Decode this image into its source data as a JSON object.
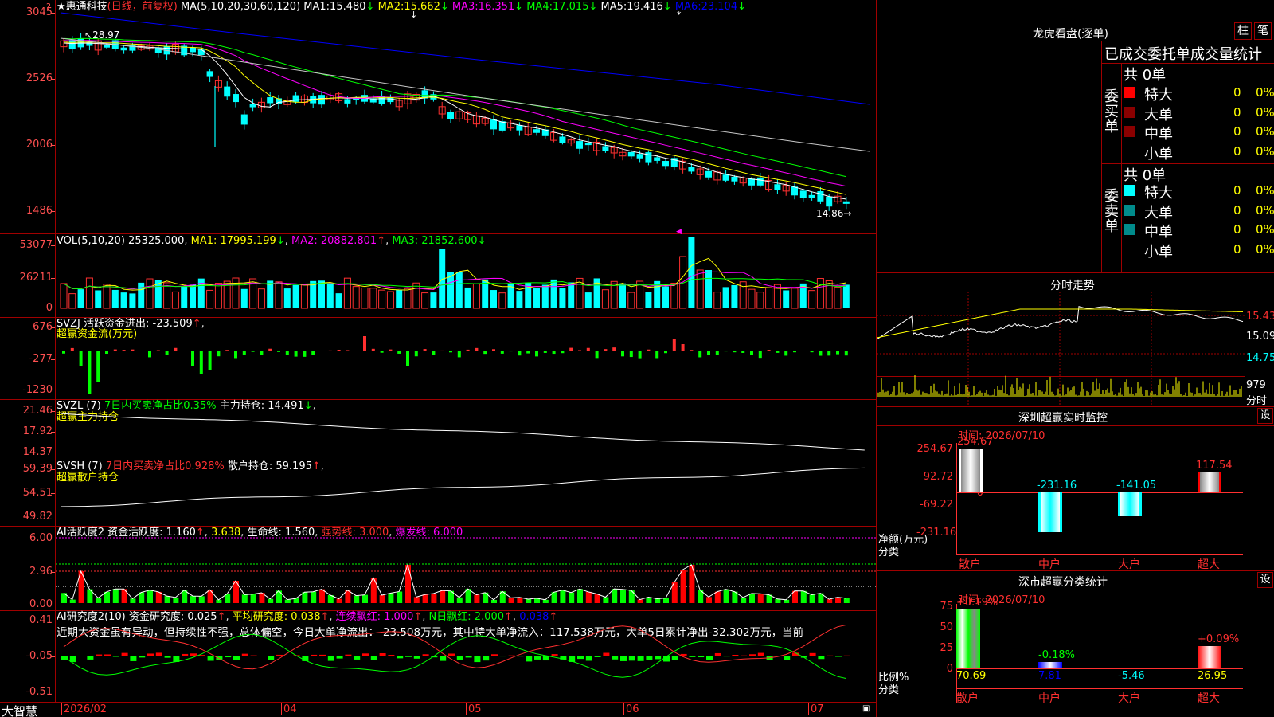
{
  "stock": {
    "star": "★",
    "name": "惠通科技",
    "period": "(日线，前复权)",
    "ma_header": "MA(5,10,20,30,60,120)",
    "ma": [
      {
        "label": "MA1:",
        "value": "15.480",
        "arrow": "↓",
        "color": "#ffffff"
      },
      {
        "label": "MA2:",
        "value": "15.662",
        "arrow": "↓",
        "color": "#ffff00"
      },
      {
        "label": "MA3:",
        "value": "16.351",
        "arrow": "↓",
        "color": "#ff00ff"
      },
      {
        "label": "MA4:",
        "value": "17.015",
        "arrow": "↓",
        "color": "#00ff00"
      },
      {
        "label": "MA5:",
        "value": "19.416",
        "arrow": "↓",
        "color": "#ffffff"
      },
      {
        "label": "MA6:",
        "value": "23.104",
        "arrow": "↓",
        "color": "#0000ff"
      }
    ],
    "price_labels": [
      "3045",
      "2526",
      "2006",
      "1486"
    ],
    "high_mark": "28.97",
    "low_mark": "14.86"
  },
  "vol": {
    "header": "VOL(5,10,20)",
    "value": "25325.000",
    "ma1": "MA1: 17995.199",
    "ma1_arrow": "↓",
    "ma2": "MA2: 20882.801",
    "ma2_arrow": "↑",
    "ma3": "MA3: 21852.600",
    "ma3_arrow": "↓",
    "labels": [
      "53077",
      "26211",
      "0"
    ]
  },
  "svzj": {
    "name": "SVZJ",
    "text": "活跃资金进出: -23.509",
    "arrow": "↑",
    "subtitle": "超赢资金流(万元)",
    "labels": [
      "676",
      "-277",
      "-1230"
    ]
  },
  "svzl": {
    "name": "SVZL (7)",
    "text": "7日内买卖净占比0.35%",
    "main": "主力持仓: 14.491",
    "arrow": "↓",
    "subtitle": "超赢主力持仓",
    "labels": [
      "21.46",
      "17.92",
      "14.37"
    ]
  },
  "svsh": {
    "name": "SVSH (7)",
    "text": "7日内买卖净占比0.928%",
    "retail": "散户持仓: 59.195",
    "arrow": "↑",
    "subtitle": "超赢散户持仓",
    "labels": [
      "59.39",
      "54.51",
      "49.82"
    ]
  },
  "ai1": {
    "name": "AI活跃度2",
    "a": "资金活跃度: 1.160",
    "a_arrow": "↑",
    "b": "3.638",
    "c": "生命线: 1.560",
    "d": "强势线: 3.000",
    "e": "爆发线: 6.000",
    "labels": [
      "6.00",
      "2.96",
      "0.00"
    ]
  },
  "ai2": {
    "name": "AI研究度2(10)",
    "a": "资金研究度: 0.025",
    "a_arrow": "↑",
    "b": "平均研究度: 0.038",
    "b_arrow": "↑",
    "c": "连续飘红: 1.000",
    "c_arrow": "↑",
    "d": "N日飘红: 2.000",
    "d_arrow": "↑",
    "e": "0.038",
    "e_arrow": "↑",
    "comment": "近期大资金虽有异动，但持续性不强，总体偏空，今日大单净流出：-23.508万元，其中特大单净流入：117.538万元，大单5日累计净出-32.302万元，当前",
    "labels": [
      "0.41",
      "-0.05",
      "-0.51"
    ]
  },
  "bottom": {
    "brand": "大智慧",
    "dates": [
      "2026/02",
      "04",
      "05",
      "06",
      "07"
    ]
  },
  "right": {
    "title": "龙虎看盘(逐单)",
    "tab1": "柱",
    "tab2": "笔",
    "stat_title": "已成交委托单成交量统计",
    "buy_side": "委买单",
    "sell_side": "委卖单",
    "total_buy": "共 0单",
    "total_sell": "共 0单",
    "rows": [
      {
        "name": "特大",
        "count": "0",
        "pct": "0%"
      },
      {
        "name": "大单",
        "count": "0",
        "pct": "0%"
      },
      {
        "name": "中单",
        "count": "0",
        "pct": "0%"
      },
      {
        "name": "小单",
        "count": "0",
        "pct": "0%"
      }
    ],
    "buy_colors": [
      "#ff0000",
      "#8b0000",
      "#8b0000",
      ""
    ],
    "sell_colors": [
      "#00ffff",
      "#008b8b",
      "#008b8b",
      ""
    ],
    "intraday_title": "分时走势",
    "intraday_labels": [
      "15.43",
      "15.09",
      "14.75"
    ],
    "intraday_vol_label": "979",
    "intraday_sub": "分时",
    "monitor_title": "深圳超赢实时监控",
    "settings": "设",
    "monitor_time": "时间: 2026/07/10",
    "monitor_labels": [
      "254.67",
      "92.72",
      "0",
      "-69.22",
      "-231.16"
    ],
    "monitor_axis_title": "净额(万元)",
    "monitor_axis_sub": "分类",
    "monitor_bars": [
      {
        "cat": "散户",
        "value": 254.67,
        "label": "254.67"
      },
      {
        "cat": "中户",
        "value": -231.16,
        "label": "-231.16"
      },
      {
        "cat": "大户",
        "value": -141.05,
        "label": "-141.05"
      },
      {
        "cat": "超大",
        "value": 117.54,
        "label": "117.54"
      }
    ],
    "class_title": "深市超赢分类统计",
    "class_time": "时间: 2026/07/10",
    "class_labels": [
      "75",
      "50",
      "25",
      "0"
    ],
    "class_axis_title": "比例%",
    "class_axis_sub": "分类",
    "class_bars": [
      {
        "cat": "散户",
        "value": 70.69,
        "top_label": "+0.19%",
        "bottom_label": "70.69"
      },
      {
        "cat": "中户",
        "value": 7.81,
        "top_label": "-0.18%",
        "bottom_label": "7.81"
      },
      {
        "cat": "大户",
        "value": 0,
        "top_label": "",
        "bottom_label": "-5.46"
      },
      {
        "cat": "超大",
        "value": 26.95,
        "top_label": "+0.09%",
        "bottom_label": "26.95"
      }
    ]
  }
}
